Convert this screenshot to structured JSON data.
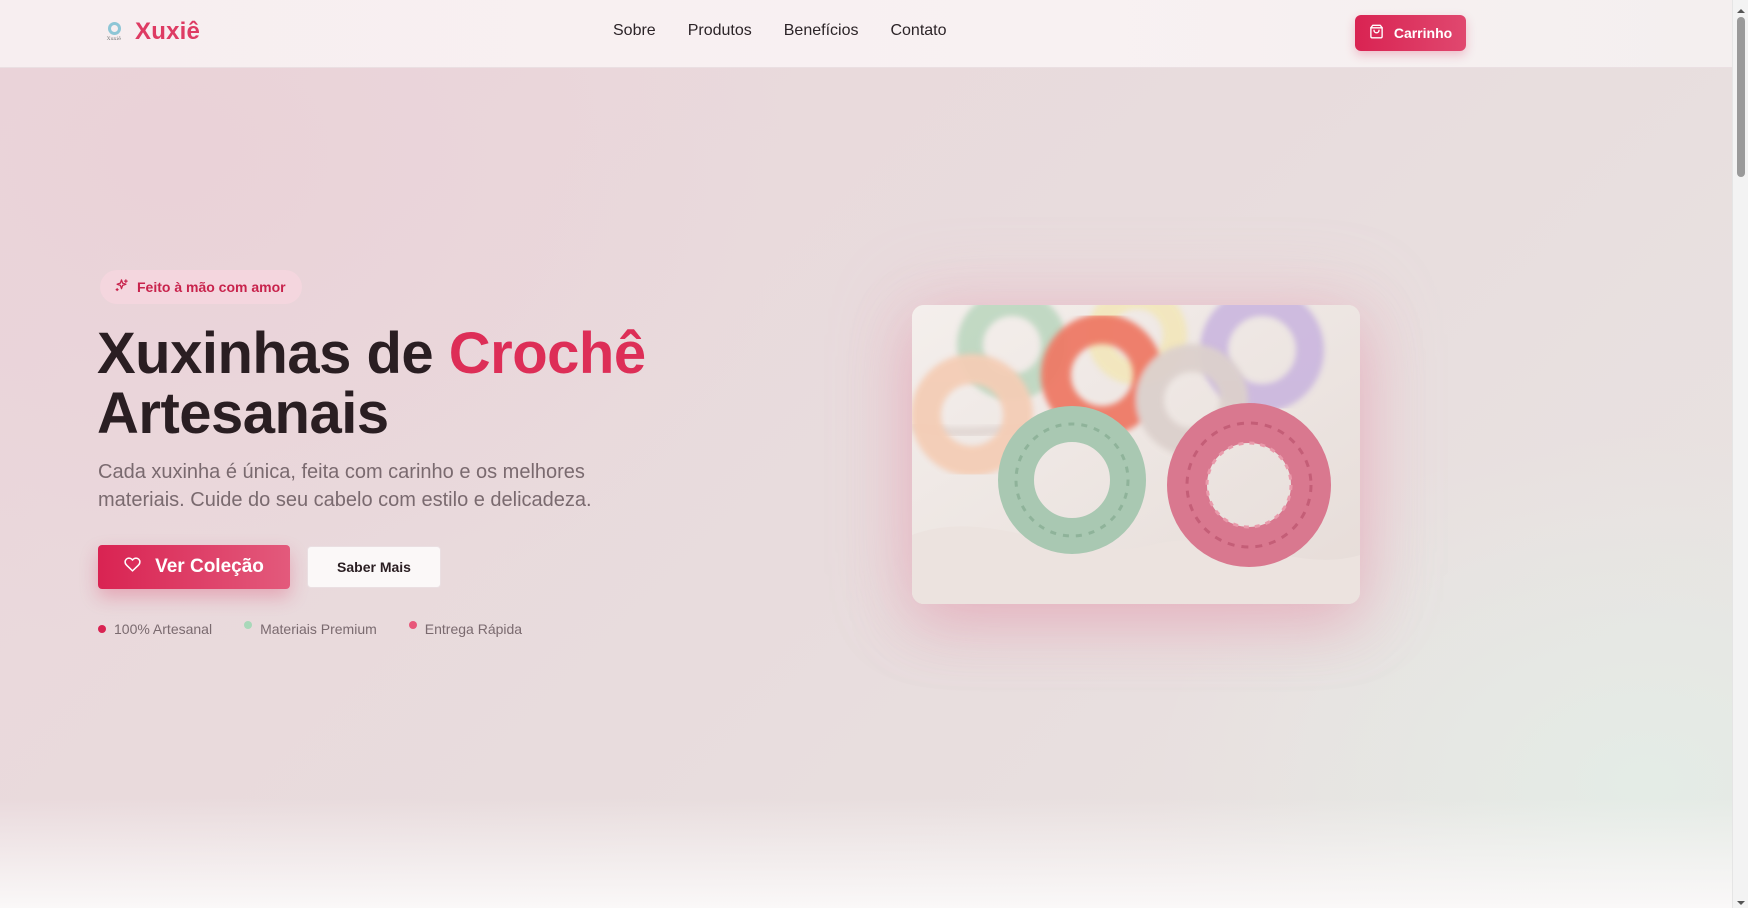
{
  "header": {
    "brand": "Xuxiê",
    "logo_small_text": "Xuxiê",
    "nav": [
      {
        "label": "Sobre"
      },
      {
        "label": "Produtos"
      },
      {
        "label": "Benefícios"
      },
      {
        "label": "Contato"
      }
    ],
    "cart_label": "Carrinho",
    "cart_icon": "shopping-bag-icon"
  },
  "hero": {
    "badge": {
      "icon": "sparkles-icon",
      "label": "Feito à mão com amor"
    },
    "title_part1": "Xuxinhas de ",
    "title_accent": "Crochê",
    "title_part2": "Artesanais",
    "subtitle": "Cada xuxinha é única, feita com carinho e os melhores materiais. Cuide do seu cabelo com estilo e delicadeza.",
    "primary_button": {
      "icon": "heart-icon",
      "label": "Ver Coleção"
    },
    "secondary_button": {
      "label": "Saber Mais"
    },
    "features": [
      {
        "label": "100% Artesanal",
        "dot_color": "#d92352"
      },
      {
        "label": "Materiais Premium",
        "dot_color": "#a8d8b9"
      },
      {
        "label": "Entrega Rápida",
        "dot_color": "#e8577a"
      }
    ],
    "image": {
      "alt": "Xuxinhas de crochê coloridas"
    }
  },
  "colors": {
    "accent": "#dd2e57",
    "button_gradient_start": "#d92352",
    "button_gradient_end": "#e35a7c"
  }
}
